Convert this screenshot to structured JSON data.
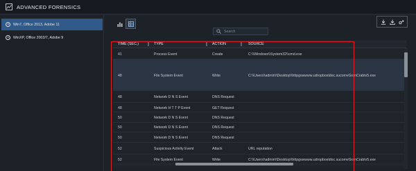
{
  "app": {
    "title": "ADVANCED FORENSICS"
  },
  "sidebar": {
    "items": [
      {
        "label": "Win7, Office 2013, Adobe 11",
        "active": true
      },
      {
        "label": "WinXP, Office 2003/7, Adobe 9",
        "active": false
      }
    ]
  },
  "toolbar": {
    "view_toggle": [
      "bar-chart-icon",
      "table-icon"
    ],
    "actions": [
      "download-icon",
      "download-all-icon",
      "share-icon"
    ]
  },
  "search": {
    "placeholder": "Search",
    "value": ""
  },
  "table": {
    "columns": [
      "TIME (SEC.)",
      "TYPE",
      "ACTION",
      "SOURCE"
    ],
    "rows": [
      {
        "time": "41",
        "type": "Process Event",
        "action": "Create",
        "source": "C:\\\\Windows\\\\System32\\\\cmd.exe"
      },
      {
        "time": "48",
        "type": "File System Event",
        "action": "Write",
        "source": "C:\\\\Users\\\\admin\\\\Desktop\\\\httpgvwwww.udropboxtdoc.sucomvGranCrabtv5.exe",
        "selected": true
      },
      {
        "time": "48",
        "type": "Network D N S Event",
        "action": "DNS Request",
        "source": ""
      },
      {
        "time": "48",
        "type": "Network H T T P Event",
        "action": "GET Request",
        "source": ""
      },
      {
        "time": "50",
        "type": "Network D N S Event",
        "action": "DNS Request",
        "source": ""
      },
      {
        "time": "50",
        "type": "Network D N S Event",
        "action": "DNS Request",
        "source": ""
      },
      {
        "time": "50",
        "type": "Network D N S Event",
        "action": "DNS Request",
        "source": ""
      },
      {
        "time": "52",
        "type": "Suspicious Activity Event",
        "action": "Attack",
        "source": "URL reputation"
      },
      {
        "time": "52",
        "type": "File System Event",
        "action": "Write",
        "source": "C:\\\\Users\\\\admin\\\\Desktop\\\\httpgvwwww.udropboxtdoc.sucomvGranCrabtv5.exe"
      }
    ]
  },
  "colors": {
    "accent": "#2f5a8a",
    "highlight": "#e41e26",
    "background": "#1d2128"
  }
}
